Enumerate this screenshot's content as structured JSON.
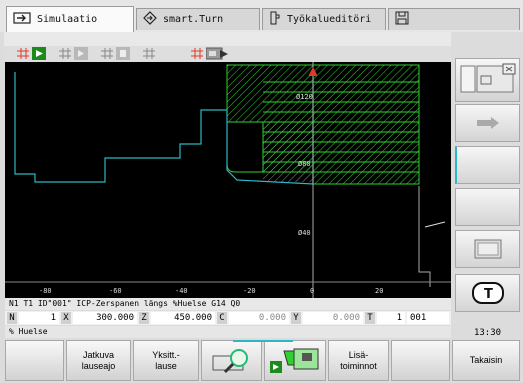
{
  "tabs": [
    {
      "label": "Simulaatio",
      "icon": "arrow-right-icon",
      "active": true
    },
    {
      "label": "smart.Turn",
      "icon": "diamond-arrow-icon",
      "active": false
    },
    {
      "label": "Työkalueditöri",
      "icon": "tool-icon",
      "active": false
    },
    {
      "label": "",
      "icon": "save-icon",
      "active": false
    }
  ],
  "graphic": {
    "axis_labels": [
      "-80",
      "-60",
      "-40",
      "-20",
      "0",
      "20"
    ],
    "dim_labels": [
      "Ø120",
      "Ø80",
      "Ø40"
    ]
  },
  "info": {
    "block": "N1 T1 ID\"001\" ICP-Zerspanen längs %Huelse  G14 Q0",
    "note": "% Huelse"
  },
  "positions": [
    {
      "label": "N",
      "value": "1"
    },
    {
      "label": "X",
      "value": "300.000"
    },
    {
      "label": "Z",
      "value": "450.000"
    },
    {
      "label": "C",
      "value": "0.000"
    },
    {
      "label": "Y",
      "value": "0.000"
    },
    {
      "label": "T",
      "value": "1"
    },
    {
      "label": "",
      "value": "001"
    }
  ],
  "clock": "13:30",
  "softkeys": {
    "k2": "Jatkuva lauseajo",
    "k3": "Yksitt.- lause",
    "k6": "Lisä- toiminnot",
    "k8": "Takaisin"
  },
  "colors": {
    "green": "#2fd12f",
    "cyan": "#2bb7c4",
    "red": "#e03a2a"
  }
}
